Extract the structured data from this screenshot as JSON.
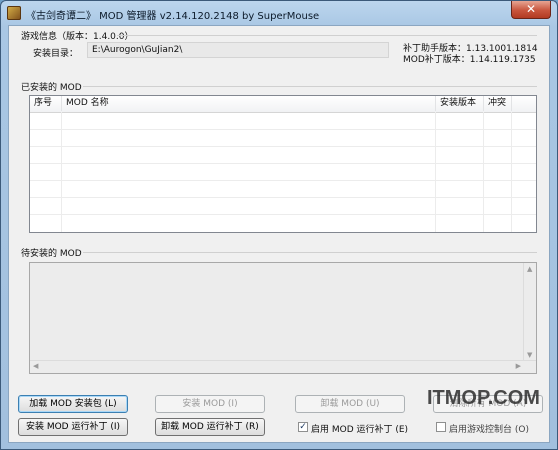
{
  "window": {
    "title": "《古剑奇谭二》 MOD 管理器 v2.14.120.2148 by SuperMouse",
    "close_glyph": "✕"
  },
  "game_info": {
    "header": "游戏信息（版本：1.4.0.0）",
    "install_dir_label": "安装目录：",
    "install_dir_value": "E:\\Aurogon\\GuJian2\\",
    "patch_helper_version": "补丁助手版本：1.13.1001.1814",
    "mod_patch_version": "MOD补丁版本：1.14.119.1735"
  },
  "installed": {
    "header": "已安装的 MOD",
    "columns": [
      "序号",
      "MOD 名称",
      "安装版本",
      "冲突"
    ],
    "rows": []
  },
  "pending": {
    "header": "待安装的 MOD",
    "items": []
  },
  "buttons": {
    "load_pkg": "加载 MOD 安装包 (L)",
    "install_mod": "安装 MOD (I)",
    "uninstall_mod": "卸载 MOD (U)",
    "clear_all": "清除所有 MOD (A)",
    "install_patch": "安装 MOD 运行补丁 (I)",
    "uninstall_patch": "卸载 MOD 运行补丁 (R)",
    "enable_patch": "启用 MOD 运行补丁 (E)",
    "start_game": "启用游戏控制台 (O)"
  },
  "watermark": "ITMOP.COM",
  "colors": {
    "title_bg": "#a9c7e4",
    "close_red": "#c8553d",
    "client_bg": "#f0f0f0"
  }
}
